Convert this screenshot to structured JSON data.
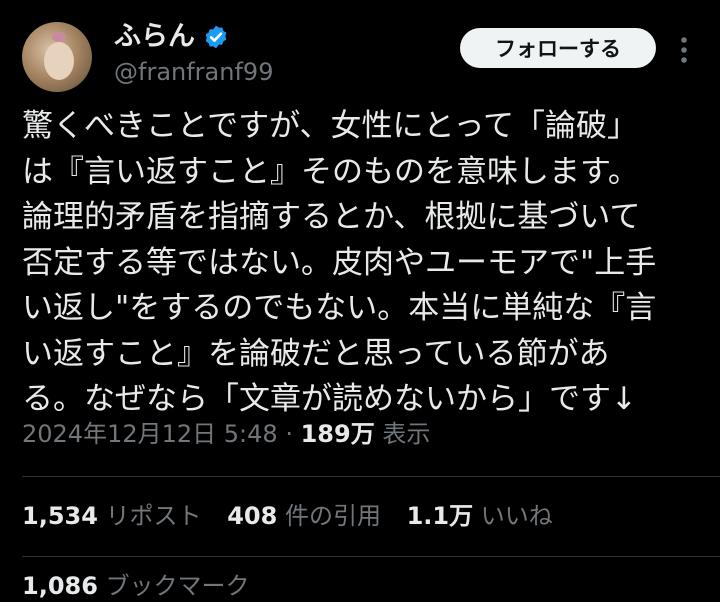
{
  "author": {
    "name": "ふらん",
    "handle": "@franfranf99",
    "verified": true
  },
  "follow_button": "フォローする",
  "post": {
    "lines": [
      "驚くべきことですが、女性にとって「論破」",
      "は『言い返すこと』そのものを意味します。",
      "論理的矛盾を指摘するとか、根拠に基づいて",
      "否定する等ではない。皮肉やユーモアで\"上手",
      "い返し\"をするのでもない。本当に単純な『言",
      "い返すこと』を論破だと思っている節があ",
      "る。なぜなら「文章が読めないから」です↓"
    ]
  },
  "meta": {
    "timestamp": "2024年12月12日 5:48",
    "separator": "·",
    "views_count": "189万",
    "views_label": "表示"
  },
  "stats": {
    "reposts_count": "1,534",
    "reposts_label": "リポスト",
    "quotes_count": "408",
    "quotes_label": "件の引用",
    "likes_count": "1.1万",
    "likes_label": "いいね",
    "bookmarks_count": "1,086",
    "bookmarks_label": "ブックマーク"
  },
  "colors": {
    "background": "#000000",
    "text": "#e7e9ea",
    "secondary": "#71767b",
    "verified": "#1d9bf0",
    "button": "#eff3f4"
  }
}
